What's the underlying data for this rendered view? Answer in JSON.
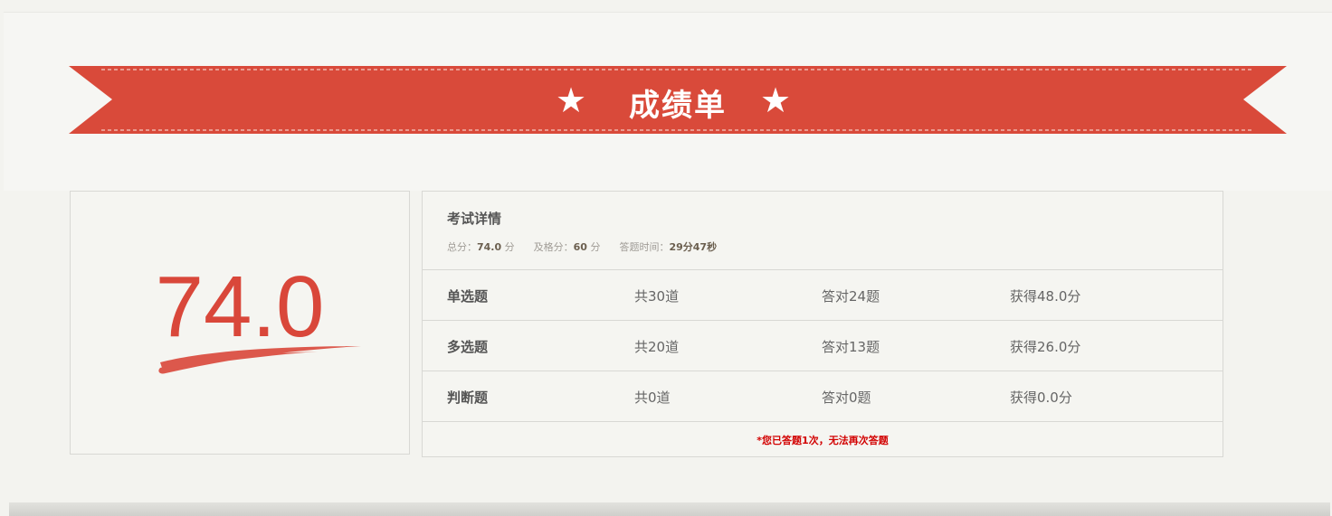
{
  "banner": {
    "title": "成绩单",
    "star_left": "★",
    "star_right": "★",
    "color": "#d94a3a"
  },
  "score": {
    "value": "74.0",
    "color": "#d9473a"
  },
  "details": {
    "title": "考试详情",
    "total_label": "总分：",
    "total_value": "74.0",
    "total_unit": "分",
    "pass_label": "及格分：",
    "pass_value": "60",
    "pass_unit": "分",
    "time_label": "答题时间：",
    "time_value": "29分47秒"
  },
  "rows": [
    {
      "type": "单选题",
      "total": "共30道",
      "correct": "答对24题",
      "points": "获得48.0分"
    },
    {
      "type": "多选题",
      "total": "共20道",
      "correct": "答对13题",
      "points": "获得26.0分"
    },
    {
      "type": "判断题",
      "total": "共0道",
      "correct": "答对0题",
      "points": "获得0.0分"
    }
  ],
  "notice": "*您已答题1次，无法再次答题"
}
